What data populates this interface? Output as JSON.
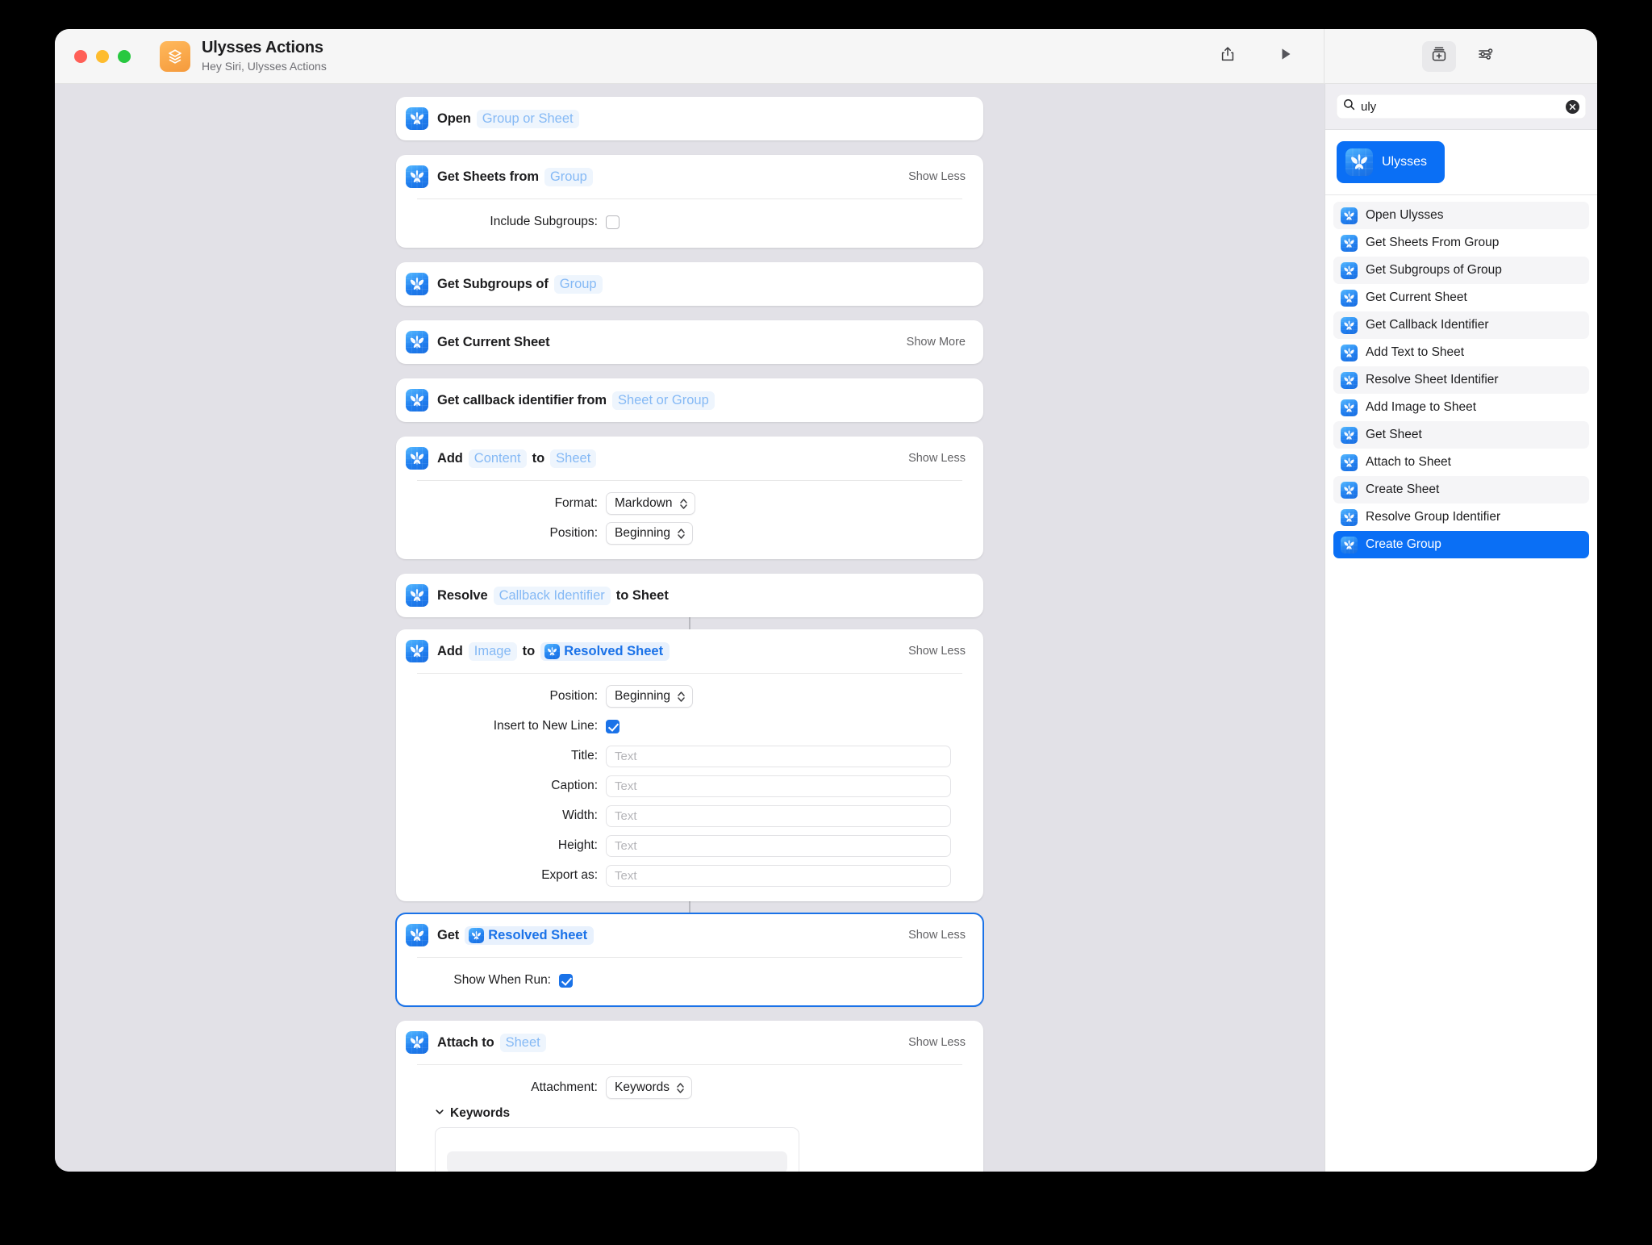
{
  "window": {
    "title": "Ulysses Actions",
    "subtitle": "Hey Siri, Ulysses Actions",
    "app_icon": "shortcuts-icon"
  },
  "toolbar": {
    "share": "share-icon",
    "run": "play-icon",
    "action_library": "add-action-icon",
    "details": "sliders-icon"
  },
  "sidebar": {
    "search": {
      "value": "uly",
      "placeholder": "Search",
      "icon": "search-icon",
      "clear": "clear-icon"
    },
    "app": {
      "name": "Ulysses",
      "icon": "ulysses-icon"
    },
    "actions": [
      {
        "label": "Open Ulysses"
      },
      {
        "label": "Get Sheets From Group"
      },
      {
        "label": "Get Subgroups of Group"
      },
      {
        "label": "Get Current Sheet"
      },
      {
        "label": "Get Callback Identifier"
      },
      {
        "label": "Add Text to Sheet"
      },
      {
        "label": "Resolve Sheet Identifier"
      },
      {
        "label": "Add Image to Sheet"
      },
      {
        "label": "Get Sheet"
      },
      {
        "label": "Attach to Sheet"
      },
      {
        "label": "Create Sheet"
      },
      {
        "label": "Resolve Group Identifier"
      },
      {
        "label": "Create Group"
      }
    ],
    "selected_action": "Create Group"
  },
  "colors": {
    "accent": "#0a6ff5",
    "canvas": "#e2e1e7",
    "token_text": "#85b9f5",
    "variable_text": "#1a72e8",
    "app_icon": "#f59a3c"
  },
  "cards": [
    {
      "id": "open",
      "parts": [
        {
          "type": "verb",
          "text": "Open"
        },
        {
          "type": "token",
          "text": "Group or Sheet"
        }
      ],
      "toggle": null,
      "selected": false,
      "connector_after": false
    },
    {
      "id": "get-sheets-from-group",
      "parts": [
        {
          "type": "verb",
          "text": "Get Sheets from"
        },
        {
          "type": "token",
          "text": "Group"
        }
      ],
      "toggle": "Show Less",
      "selected": false,
      "connector_after": false,
      "fields": [
        {
          "kind": "checkbox",
          "label": "Include Subgroups:",
          "checked": false
        }
      ]
    },
    {
      "id": "get-subgroups-of-group",
      "parts": [
        {
          "type": "verb",
          "text": "Get Subgroups of"
        },
        {
          "type": "token",
          "text": "Group"
        }
      ],
      "toggle": null,
      "selected": false,
      "connector_after": false
    },
    {
      "id": "get-current-sheet",
      "parts": [
        {
          "type": "verb",
          "text": "Get Current Sheet"
        }
      ],
      "toggle": "Show More",
      "selected": false,
      "connector_after": false
    },
    {
      "id": "get-callback-identifier",
      "parts": [
        {
          "type": "verb",
          "text": "Get callback identifier from"
        },
        {
          "type": "token",
          "text": "Sheet or Group"
        }
      ],
      "toggle": null,
      "selected": false,
      "connector_after": false
    },
    {
      "id": "add-content-to-sheet",
      "parts": [
        {
          "type": "verb",
          "text": "Add"
        },
        {
          "type": "token",
          "text": "Content"
        },
        {
          "type": "word",
          "text": "to"
        },
        {
          "type": "token",
          "text": "Sheet"
        }
      ],
      "toggle": "Show Less",
      "selected": false,
      "connector_after": false,
      "fields": [
        {
          "kind": "popup",
          "label": "Format:",
          "value": "Markdown"
        },
        {
          "kind": "popup",
          "label": "Position:",
          "value": "Beginning"
        }
      ]
    },
    {
      "id": "resolve-callback-identifier",
      "parts": [
        {
          "type": "verb",
          "text": "Resolve"
        },
        {
          "type": "token",
          "text": "Callback Identifier"
        },
        {
          "type": "word",
          "text": "to Sheet"
        }
      ],
      "toggle": null,
      "selected": false,
      "connector_after": true
    },
    {
      "id": "add-image-to-resolved-sheet",
      "parts": [
        {
          "type": "verb",
          "text": "Add"
        },
        {
          "type": "token",
          "text": "Image"
        },
        {
          "type": "word",
          "text": "to"
        },
        {
          "type": "variable",
          "text": "Resolved Sheet"
        }
      ],
      "toggle": "Show Less",
      "selected": false,
      "connector_after": true,
      "fields": [
        {
          "kind": "popup",
          "label": "Position:",
          "value": "Beginning"
        },
        {
          "kind": "checkbox",
          "label": "Insert to New Line:",
          "checked": true
        },
        {
          "kind": "text",
          "label": "Title:",
          "placeholder": "Text",
          "value": ""
        },
        {
          "kind": "text",
          "label": "Caption:",
          "placeholder": "Text",
          "value": ""
        },
        {
          "kind": "text",
          "label": "Width:",
          "placeholder": "Text",
          "value": ""
        },
        {
          "kind": "text",
          "label": "Height:",
          "placeholder": "Text",
          "value": ""
        },
        {
          "kind": "text",
          "label": "Export as:",
          "placeholder": "Text",
          "value": ""
        }
      ]
    },
    {
      "id": "get-resolved-sheet",
      "parts": [
        {
          "type": "verb",
          "text": "Get"
        },
        {
          "type": "variable",
          "text": "Resolved Sheet"
        }
      ],
      "toggle": "Show Less",
      "selected": true,
      "connector_after": false,
      "fields": [
        {
          "kind": "checkbox",
          "label": "Show When Run:",
          "checked": true,
          "narrow": true
        }
      ]
    },
    {
      "id": "attach-to-sheet",
      "parts": [
        {
          "type": "verb",
          "text": "Attach to"
        },
        {
          "type": "token",
          "text": "Sheet"
        }
      ],
      "toggle": "Show Less",
      "selected": false,
      "connector_after": false,
      "fields": [
        {
          "kind": "popup",
          "label": "Attachment:",
          "value": "Keywords"
        },
        {
          "kind": "disclosure",
          "label": "Keywords"
        },
        {
          "kind": "keywordbox"
        }
      ]
    }
  ]
}
